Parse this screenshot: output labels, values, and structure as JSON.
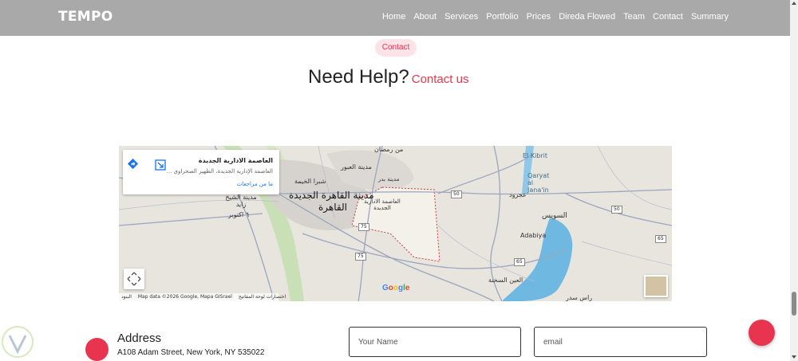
{
  "brand": "TEMPO",
  "nav": [
    "Home",
    "About",
    "Services",
    "Portfolio",
    "Prices",
    "Direda Flowed",
    "Team",
    "Contact",
    "Summary"
  ],
  "section": {
    "badge": "Contact",
    "title": "Need Help?",
    "title_accent": "Contact us"
  },
  "map": {
    "place_name": "العاصمة الادارية الجديدة",
    "place_address": "العاصمة الإدارية الجديدة، الظهير الصحراوي ...",
    "reviews": "ما من مراجعات",
    "labels": {
      "cairo_new": "مدينة القاهرة الجديدة",
      "cairo": "القاهرة",
      "capital": "العاصمة الادارية الجديدة",
      "badr": "مدينة بدر",
      "obour": "مدينة العبور",
      "shubra": "شبرا الخيمة",
      "sheikh_zayed": "مدينة الشيخ زايد",
      "october": "٦ اكتوبر",
      "ramadan": "من رمضان",
      "suez": "السويس",
      "ain_sokhna": "العين السخنة",
      "ajrud": "عجرود",
      "el_kibrit": "El Kibrit",
      "qaryat": "Qaryat al Jana'in",
      "adabiya": "Adabiya",
      "ras_sedr": "راس سدر"
    },
    "roads": [
      "50",
      "50",
      "75",
      "65",
      "65",
      "75"
    ],
    "footer": {
      "terms": "البنود",
      "data": "Map data ©2026 Google, Mapa GISrael",
      "shortcuts": "اختصارات لوحة المفاتيح"
    },
    "google": [
      "G",
      "o",
      "o",
      "g",
      "l",
      "e"
    ]
  },
  "contact": {
    "address_label": "Address",
    "address_value": "A108 Adam Street, New York, NY 535022"
  },
  "form": {
    "name_placeholder": "Your Name",
    "email_placeholder": "email"
  },
  "colors": {
    "accent": "#e8344e",
    "navbar": "#a9a9a9",
    "badge_bg": "#fbe3e7"
  }
}
